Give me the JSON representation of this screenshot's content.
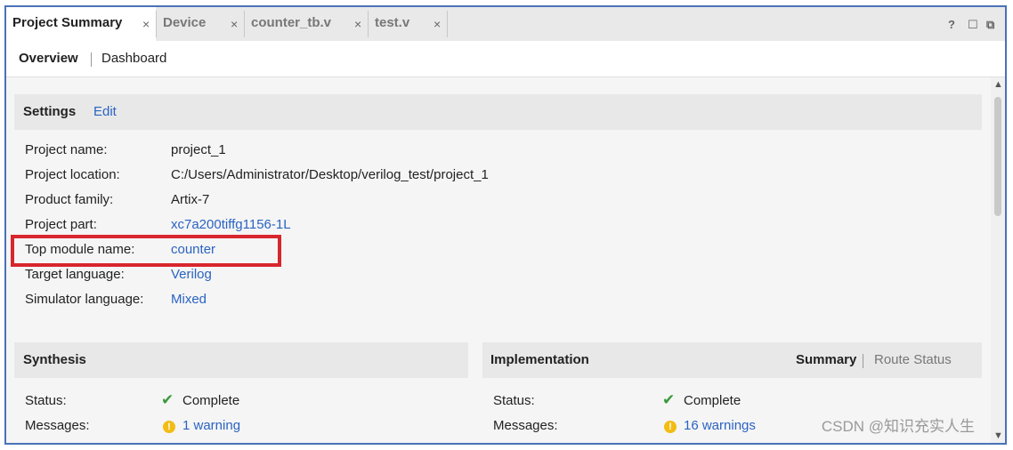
{
  "tabs": [
    {
      "label": "Project Summary"
    },
    {
      "label": "Device"
    },
    {
      "label": "counter_tb.v"
    },
    {
      "label": "test.v"
    }
  ],
  "tab_close_glyph": "×",
  "window_controls": {
    "help": "?",
    "maximize": "☐",
    "float": "⧉"
  },
  "subtabs": {
    "overview": "Overview",
    "dashboard": "Dashboard"
  },
  "settings": {
    "title": "Settings",
    "edit_link": "Edit",
    "rows": [
      {
        "label": "Project name:",
        "value": "project_1"
      },
      {
        "label": "Project location:",
        "value": "C:/Users/Administrator/Desktop/verilog_test/project_1"
      },
      {
        "label": "Product family:",
        "value": "Artix-7"
      },
      {
        "label": "Project part:",
        "value": "xc7a200tiffg1156-1L"
      },
      {
        "label": "Top module name:",
        "value": "counter"
      },
      {
        "label": "Target language:",
        "value": "Verilog"
      },
      {
        "label": "Simulator language:",
        "value": "Mixed"
      }
    ]
  },
  "synthesis": {
    "title": "Synthesis",
    "status_label": "Status:",
    "status_value": "Complete",
    "messages_label": "Messages:",
    "messages_value": "1 warning"
  },
  "implementation": {
    "title": "Implementation",
    "summary_link": "Summary",
    "route_status_link": "Route Status",
    "status_label": "Status:",
    "status_value": "Complete",
    "messages_label": "Messages:",
    "messages_value": "16 warnings"
  },
  "watermark": "CSDN @知识充实人生",
  "colors": {
    "link": "#2a63c2",
    "highlight": "#d8262d",
    "check": "#3a9a3a",
    "warning": "#f2bc14"
  }
}
